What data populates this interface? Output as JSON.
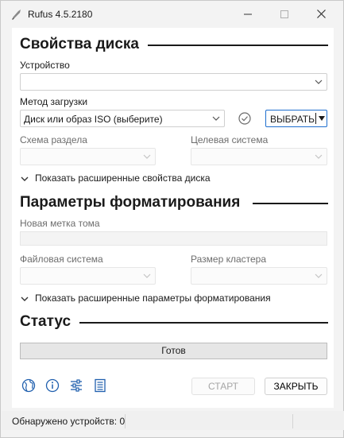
{
  "window": {
    "title": "Rufus 4.5.2180",
    "minimize": "—",
    "maximize": "☐",
    "close": "✕"
  },
  "drive_props": {
    "heading": "Свойства диска",
    "device_label": "Устройство",
    "device_value": "",
    "boot_label": "Метод загрузки",
    "boot_value": "Диск или образ ISO (выберите)",
    "select_button": "ВЫБРАТЬ",
    "partition_label": "Схема раздела",
    "target_label": "Целевая система",
    "advanced_toggle": "Показать расширенные свойства диска"
  },
  "format_opts": {
    "heading": "Параметры форматирования",
    "volume_label": "Новая метка тома",
    "filesystem_label": "Файловая система",
    "cluster_label": "Размер кластера",
    "advanced_toggle": "Показать расширенные параметры форматирования"
  },
  "status": {
    "heading": "Статус",
    "value": "Готов"
  },
  "toolbar": {
    "icons": [
      "globe-icon",
      "info-icon",
      "settings-sliders-icon",
      "log-icon"
    ],
    "start_button": "СТАРТ",
    "close_button": "ЗАКРЫТЬ"
  },
  "statusbar": {
    "text": "Обнаружено устройств: 0"
  },
  "colors": {
    "accent": "#1f6fcf",
    "icon_blue": "#1f5fae",
    "heading": "#1a1a1a"
  }
}
